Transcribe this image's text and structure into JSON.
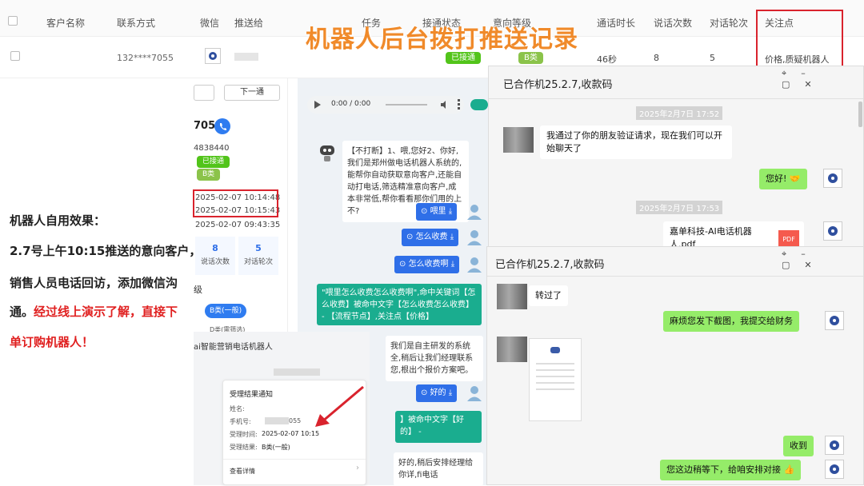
{
  "title": "机器人后台拨打推送记录",
  "table": {
    "headers": [
      "客户名称",
      "联系方式",
      "微信",
      "推送给",
      "任务",
      "接通状态",
      "意向等级",
      "通话时长",
      "说话次数",
      "对话轮次",
      "关注点"
    ],
    "row": {
      "phone": "132****7055",
      "status": "已接通",
      "level": "B类",
      "duration": "46秒",
      "speak": "8",
      "rounds": "5",
      "focus": "价格,质疑机器人"
    }
  },
  "left": {
    "line1": "机器人自用效果：",
    "line2": "2.7号上午10:15推送的意向客户，",
    "line3": "销售人员电话回访，添加微信沟",
    "line4a": "通。",
    "line4b": "经过线上演示了解，直接下",
    "line5": "单订购机器人！"
  },
  "detail": {
    "next": "下一通",
    "phone": "7055",
    "id": "4838440",
    "tag1": "已接通",
    "tag2": "B类",
    "t1": "2025-02-07 10:14:48",
    "t2": "2025-02-07 10:15:43",
    "t3": "2025-02-07 09:43:35",
    "speak_num": "8",
    "speak_lbl": "说话次数",
    "round_num": "5",
    "round_lbl": "对话轮次",
    "sec": "级",
    "b_btn": "B类(一般)",
    "d_opt": "D类(需筛选)"
  },
  "chat": {
    "audio": "0:00 / 0:00",
    "bot_msg": "【不打断】1、喂,您好2、你好,我们是郑州做电话机器人系统的,能帮你自动获取意向客户,还能自动打电话,筛选精准意向客户,成本非常低,帮你看看那你们用的上不?",
    "u1": "喂里",
    "u2": "怎么收费",
    "u3": "怎么收费啊",
    "hit": "\"喂里怎么收费怎么收费啊\",命中关键词【怎么收费】被命中文字【怎么收费怎么收费】 - 【流程节点】,关注点【价格】",
    "bot2": "我们是自主研发的系统全,稍后让我们经理联系您,根出个报价方案吧。",
    "u4": "好的",
    "hit2": "】被命中文字【好的】 -",
    "bot3": "好的,稍后安排经理给你详,fi电话"
  },
  "notify": {
    "app": "ai智能营销电话机器人",
    "card_title": "受理结果通知",
    "name_lbl": "姓名:",
    "phone_lbl": "手机号:",
    "phone_val": "055",
    "time_lbl": "受理时间:",
    "time_val": "2025-02-07 10:15",
    "res_lbl": "受理结果:",
    "res_val": "B类(一般)",
    "more": "查看详情"
  },
  "wechat1": {
    "title": "已合作机25.2.7,收款码",
    "date1": "2025年2月7日 17:52",
    "msg1": "我通过了你的朋友验证请求，现在我们可以开始聊天了",
    "msg2": "您好!",
    "date2": "2025年2月7日 17:53",
    "file": "嘉单科技-AI电话机器人.pdf",
    "pdf": "PDF"
  },
  "wechat2": {
    "title": "已合作机25.2.7,收款码",
    "msg1": "转过了",
    "msg2": "麻烦您发下截图，我提交给财务",
    "msg3": "收到",
    "msg4": "您这边稍等下，给咱安排对接"
  },
  "colors": {
    "title": "#f08a2a",
    "red": "#d9232d",
    "green": "#52c41a",
    "blue": "#2f6fe8",
    "teal": "#1aad8f",
    "wxgreen": "#95ec69"
  }
}
